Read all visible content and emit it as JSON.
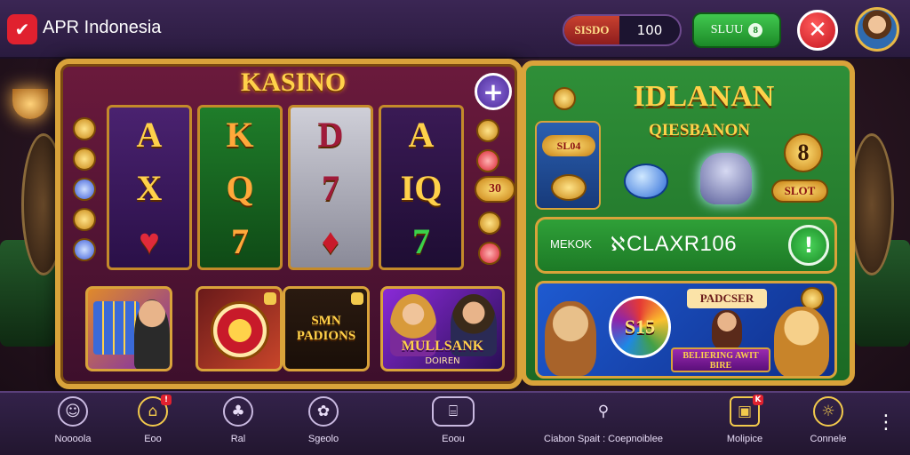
{
  "app": {
    "logo_glyph": "✔",
    "title": "APR Indonesia"
  },
  "topbar": {
    "balance_label": "SISDO",
    "balance_value": "100",
    "action_label": "SLUU",
    "action_glyph": "8",
    "close_glyph": "✕"
  },
  "slot_machine": {
    "title": "KASINO",
    "plus_glyph": "+",
    "reels": [
      [
        "A",
        "X",
        "♥"
      ],
      [
        "K",
        "Q",
        "7"
      ],
      [
        "D",
        "7",
        "♦"
      ],
      [
        "A",
        "IQ",
        "7"
      ]
    ],
    "side_badge": "30",
    "games": [
      {
        "title": ""
      },
      {
        "title": ""
      },
      {
        "title": "SMN PADIONS"
      },
      {
        "title": "MULLSANK",
        "subtitle": "DOIREN"
      }
    ]
  },
  "green_panel": {
    "title": "IDLANAN",
    "subtitle": "QIESBANON",
    "tile_badge": "SL04",
    "big_number": "8",
    "slot_badge": "SLOT",
    "search": {
      "label": "MEKOK",
      "value": "CLAXR106",
      "glyph_left": "ℵ",
      "button_glyph": "!"
    },
    "promo": {
      "wheel_text": "S15",
      "title": "PADCSER",
      "ribbon": "BELIERING AWIT BIRE"
    }
  },
  "bottom_nav": [
    {
      "label": "Noooola",
      "icon": "smile-icon",
      "glyph": "☺",
      "gold": false,
      "badge": ""
    },
    {
      "label": "Eoo",
      "icon": "home-icon",
      "glyph": "⌂",
      "gold": true,
      "badge": "!"
    },
    {
      "label": "Ral",
      "icon": "clubs-icon",
      "glyph": "♣",
      "gold": false,
      "badge": ""
    },
    {
      "label": "Sgeolo",
      "icon": "chip-icon",
      "glyph": "✿",
      "gold": false,
      "badge": ""
    },
    {
      "label": "Eoou",
      "icon": "door-icon",
      "glyph": "⌸",
      "gold": false,
      "badge": ""
    },
    {
      "label": "Ciabon Spait : Coepnoiblee",
      "icon": "search-icon",
      "glyph": "⚲",
      "gold": false,
      "badge": ""
    },
    {
      "label": "Molipice",
      "icon": "ticket-icon",
      "glyph": "▣",
      "gold": true,
      "badge": "K"
    },
    {
      "label": "Connele",
      "icon": "sun-icon",
      "glyph": "☼",
      "gold": true,
      "badge": ""
    }
  ],
  "colors": {
    "accent_gold": "#d9a33a",
    "close_red": "#c4151e",
    "action_green": "#1c8a28",
    "nav_bg": "#22162f"
  }
}
